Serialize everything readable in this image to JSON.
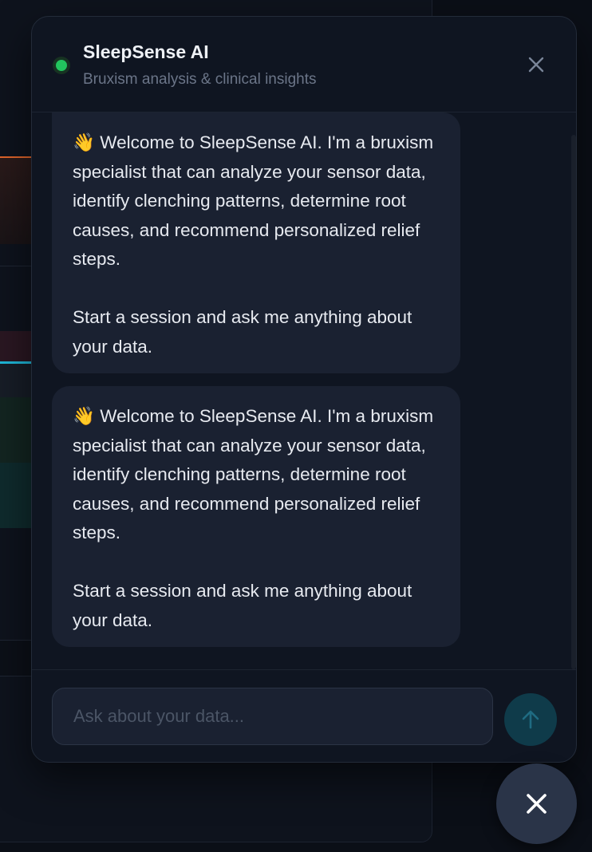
{
  "chat": {
    "title": "SleepSense AI",
    "subtitle": "Bruxism analysis & clinical insights",
    "status_color": "#22c55e",
    "messages": [
      {
        "role": "assistant",
        "text": "👋 Welcome to SleepSense AI. I'm a bruxism specialist that can analyze your sensor data, identify clenching patterns, determine root causes, and recommend personalized relief steps.\n\nStart a session and ask me anything about your data."
      },
      {
        "role": "assistant",
        "text": "👋 Welcome to SleepSense AI. I'm a bruxism specialist that can analyze your sensor data, identify clenching patterns, determine root causes, and recommend personalized relief steps.\n\nStart a session and ask me anything about your data."
      }
    ],
    "composer": {
      "placeholder": "Ask about your data...",
      "value": ""
    },
    "icons": {
      "close_panel": "close-icon",
      "send": "arrow-up-icon",
      "fab": "close-icon"
    }
  }
}
